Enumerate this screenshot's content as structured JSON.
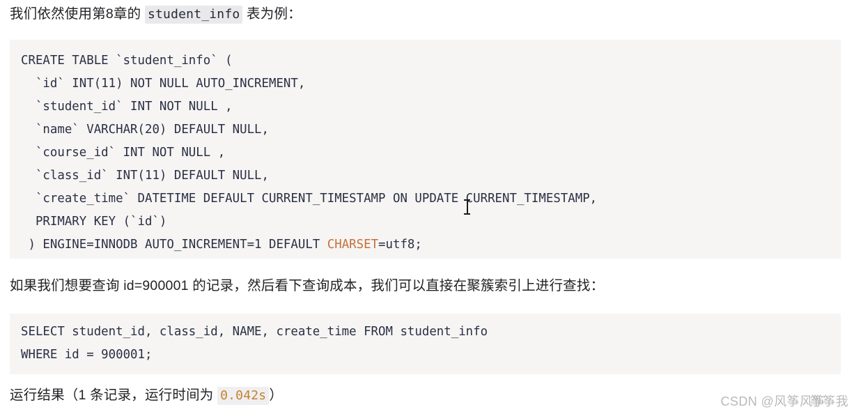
{
  "document": {
    "intro_paragraph": {
      "before": "我们依然使用第8章的 ",
      "code": "student_info",
      "after": " 表为例："
    },
    "create_table_code": {
      "lines": [
        "CREATE TABLE `student_info` (",
        "  `id` INT(11) NOT NULL AUTO_INCREMENT,",
        "  `student_id` INT NOT NULL ,",
        "  `name` VARCHAR(20) DEFAULT NULL,",
        "  `course_id` INT NOT NULL ,",
        "  `class_id` INT(11) DEFAULT NULL,",
        "  `create_time` DATETIME DEFAULT CURRENT_TIMESTAMP ON UPDATE CURRENT_TIMESTAMP,",
        "  PRIMARY KEY (`id`)",
        " ) ENGINE=INNODB AUTO_INCREMENT=1 DEFAULT "
      ],
      "last_line_prefix": " ) ENGINE=INNODB AUTO_INCREMENT=1 DEFAULT ",
      "last_line_keyword": "CHARSET",
      "last_line_suffix": "=utf8;"
    },
    "query_paragraph": "如果我们想要查询 id=900001 的记录，然后看下查询成本，我们可以直接在聚簇索引上进行查找：",
    "select_code": {
      "lines": [
        "SELECT student_id, class_id, NAME, create_time FROM student_info",
        "WHERE id = 900001;"
      ]
    },
    "result_paragraph": {
      "before": "运行结果（1 条记录，运行时间为 ",
      "code": "0.042s",
      "after": "）"
    },
    "watermark": {
      "prefix": "CSDN @风筝风筝",
      "overlap": "筝筝我"
    },
    "colors": {
      "code_background": "#f6f5f3",
      "code_text": "#2a2f45",
      "charset_keyword": "#c4703a",
      "inline_code_background": "#e9e9ec",
      "timing_value": "#c4822d",
      "watermark": "#b9b9b9",
      "body_text": "#222226"
    }
  }
}
